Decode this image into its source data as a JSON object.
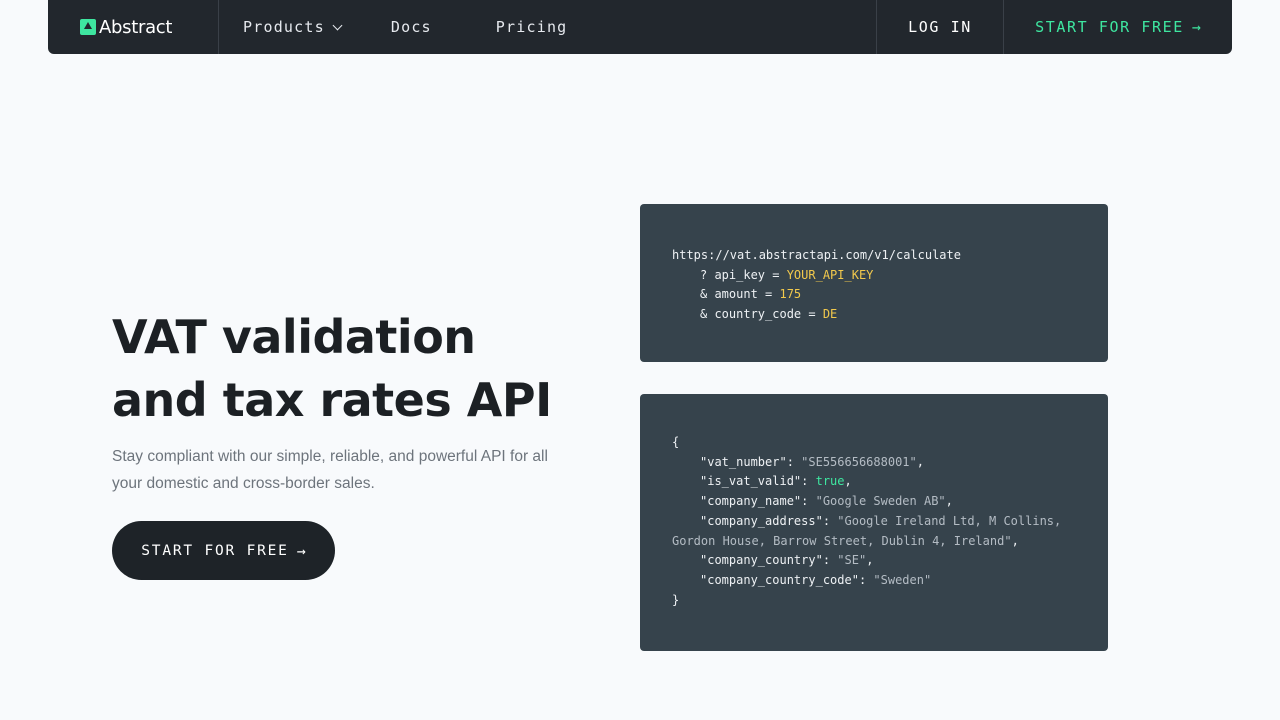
{
  "brand": {
    "name": "Abstract"
  },
  "nav": {
    "products": "Products",
    "docs": "Docs",
    "pricing": "Pricing",
    "login": "LOG IN",
    "start": "START FOR FREE",
    "arrow": "→"
  },
  "hero": {
    "title_line1": "VAT validation",
    "title_line2": "and tax rates API",
    "subtitle": "Stay compliant with our simple, reliable, and powerful API for all your domestic and cross-border sales.",
    "cta": "START FOR FREE",
    "cta_arrow": "→"
  },
  "request": {
    "url": "https://vat.abstractapi.com/v1/calculate",
    "p1_key": "? api_key = ",
    "p1_val": "YOUR_API_KEY",
    "p2_key": "& amount = ",
    "p2_val": "175",
    "p3_key": "& country_code = ",
    "p3_val": "DE"
  },
  "response": {
    "open": "{",
    "close": "}",
    "vat_number_key": "\"vat_number\"",
    "vat_number_val": "\"SE556656688001\"",
    "is_vat_valid_key": "\"is_vat_valid\"",
    "is_vat_valid_val": "true",
    "company_name_key": "\"company_name\"",
    "company_name_val": "\"Google Sweden AB\"",
    "company_address_key": "\"company_address\"",
    "company_address_val_1": "\"Google Ireland Ltd, M Collins,",
    "company_address_val_2": "Gordon House, Barrow Street, Dublin 4, Ireland\"",
    "company_country_key": "\"company_country\"",
    "company_country_val": "\"SE\"",
    "company_country_code_key": "\"company_country_code\"",
    "company_country_code_val": "\"Sweden\""
  },
  "colors": {
    "nav_bg": "#22272d",
    "accent": "#3ee6a0",
    "code_bg": "#36434c",
    "code_value": "#f2c94c"
  }
}
